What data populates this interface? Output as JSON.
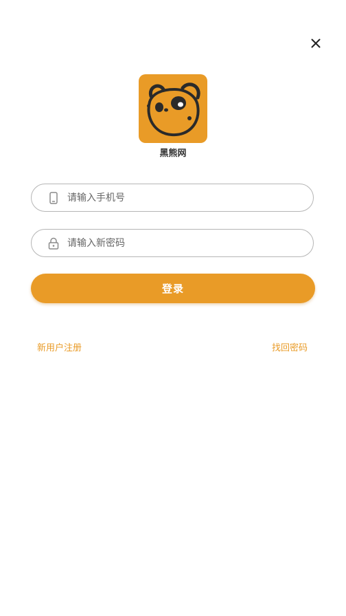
{
  "app": {
    "name": "黑熊网",
    "brand_color": "#e99b27"
  },
  "header": {
    "close_icon": "close-icon"
  },
  "form": {
    "phone": {
      "icon": "phone-icon",
      "placeholder": "请输入手机号",
      "value": ""
    },
    "password": {
      "icon": "lock-icon",
      "placeholder": "请输入新密码",
      "value": ""
    },
    "login_label": "登录"
  },
  "links": {
    "register": "新用户注册",
    "forgot": "找回密码"
  }
}
